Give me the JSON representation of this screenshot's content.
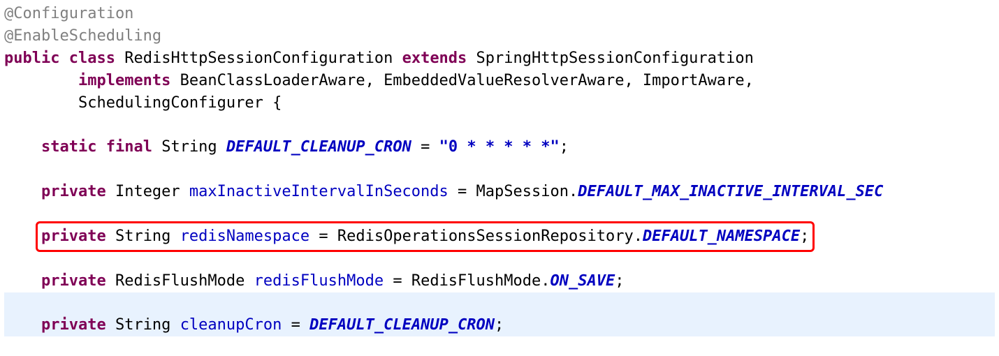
{
  "code": {
    "ann1": "@Configuration",
    "ann2": "@EnableScheduling",
    "kw_public": "public",
    "kw_class": "class",
    "class_name": "RedisHttpSessionConfiguration",
    "kw_extends": "extends",
    "super_name": "SpringHttpSessionConfiguration",
    "kw_implements": "implements",
    "ifaces": "BeanClassLoaderAware, EmbeddedValueResolverAware, ImportAware,",
    "iface2": "SchedulingConfigurer {",
    "kw_static": "static",
    "kw_final": "final",
    "type_string": "String",
    "const_name": "DEFAULT_CLEANUP_CRON",
    "eq": " = ",
    "const_val": "\"0 * * * * *\"",
    "semi": ";",
    "kw_private": "private",
    "type_integer": "Integer",
    "fld_maxInactive": "maxInactiveIntervalInSeconds",
    "mapSession": "MapSession.",
    "const_maxInactive": "DEFAULT_MAX_INACTIVE_INTERVAL_SEC",
    "fld_redisNs": "redisNamespace",
    "repo": "RedisOperationsSessionRepository.",
    "const_ns": "DEFAULT_NAMESPACE",
    "type_flush": "RedisFlushMode",
    "fld_flush": "redisFlushMode",
    "flush_qual": "RedisFlushMode.",
    "const_onsave": "ON_SAVE",
    "fld_cleanup": "cleanupCron",
    "const_cleanup_ref": "DEFAULT_CLEANUP_CRON"
  }
}
